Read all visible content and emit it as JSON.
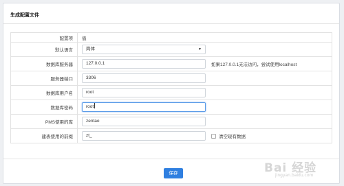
{
  "panel": {
    "title": "生成配置文件"
  },
  "table": {
    "header": {
      "label": "配置项",
      "value": "值"
    },
    "rows": {
      "language": {
        "label": "默认语言",
        "selected": "简体"
      },
      "db_host": {
        "label": "数据库服务器",
        "value": "127.0.0.1",
        "hint": "如果127.0.0.1无法访问，尝试使用localhost"
      },
      "db_port": {
        "label": "服务器端口",
        "value": "3306"
      },
      "db_user": {
        "label": "数据库用户名",
        "value": "root"
      },
      "db_password": {
        "label": "数据库密码",
        "value": "root"
      },
      "pms_db": {
        "label": "PMS使用的库",
        "value": "zentao"
      },
      "table_prefix": {
        "label": "建表使用的前缀",
        "value": "zt_",
        "checkbox_label": "清空现有数据"
      }
    }
  },
  "actions": {
    "save_label": "保存"
  },
  "watermark": {
    "text": "Bai 经验",
    "sub": "jingyan.baidu.com"
  }
}
